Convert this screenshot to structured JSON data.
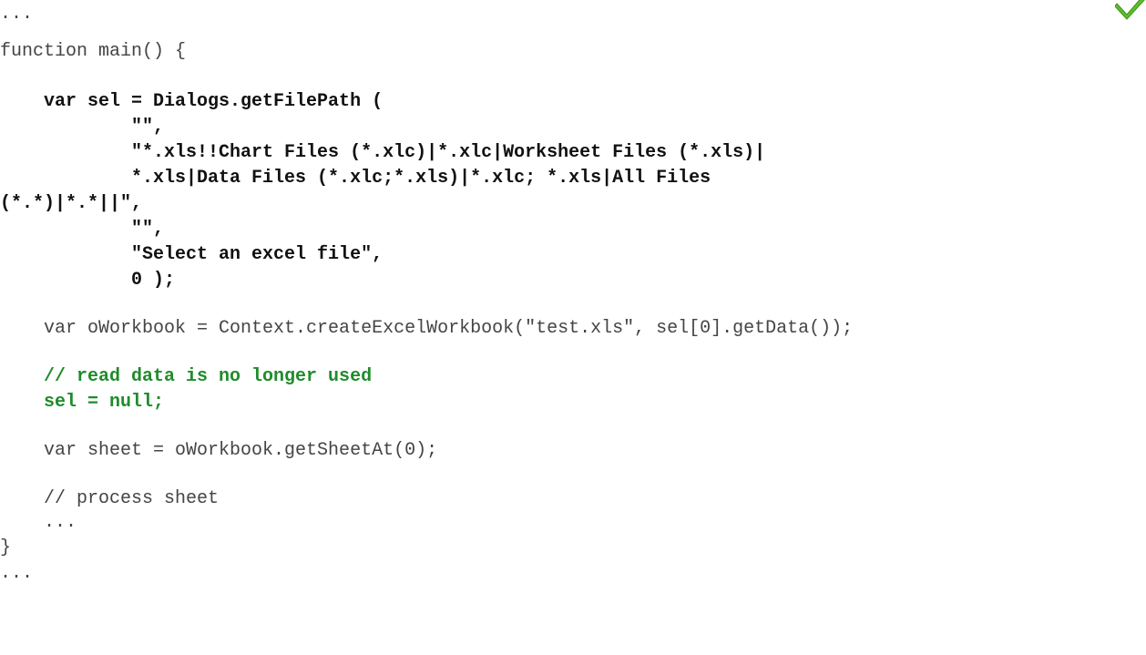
{
  "code": {
    "lines": [
      "...",
      "function main() {",
      "    var sel = Dialogs.getFilePath (",
      "            \"\",",
      "            \"*.xls!!Chart Files (*.xlc)|*.xlc|Worksheet Files (*.xls)|",
      "            *.xls|Data Files (*.xlc;*.xls)|*.xlc; *.xls|All Files",
      "(*.*)|*.*||\",",
      "            \"\",",
      "            \"Select an excel file\",",
      "            0 );",
      "    var oWorkbook = Context.createExcelWorkbook(\"test.xls\", sel[0].getData());",
      "    // read data is no longer used",
      "    sel = null;",
      "    var sheet = oWorkbook.getSheetAt(0);",
      "    // process sheet",
      "    ...",
      "}",
      "..."
    ]
  },
  "icons": {
    "corner": "check-icon"
  },
  "colors": {
    "comment_green": "#1f8c2a",
    "check_green": "#5cbf2a"
  }
}
